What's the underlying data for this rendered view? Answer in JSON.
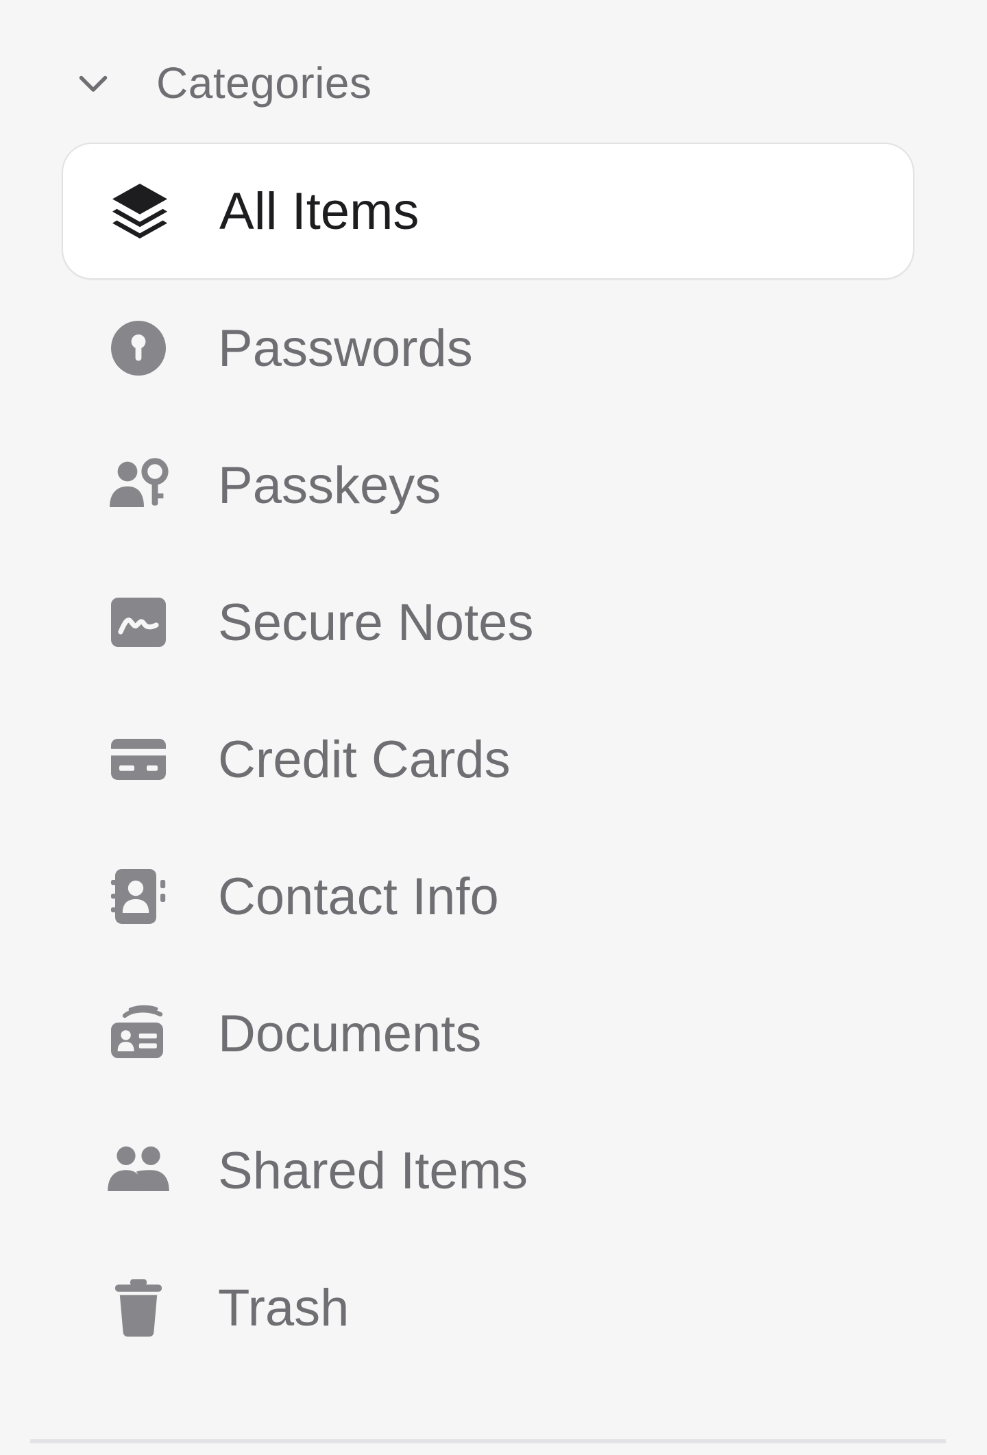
{
  "theme": {
    "background": "#f6f6f6",
    "selected_bg": "#ffffff",
    "text_muted": "#6e6e73",
    "text_selected": "#1d1d1f",
    "icon_muted": "#86868b"
  },
  "section": {
    "title": "Categories",
    "expanded": true,
    "toggle_icon": "chevron-down-icon"
  },
  "categories": [
    {
      "label": "All Items",
      "icon": "layers-icon",
      "selected": true
    },
    {
      "label": "Passwords",
      "icon": "key-icon",
      "selected": false
    },
    {
      "label": "Passkeys",
      "icon": "passkey-icon",
      "selected": false
    },
    {
      "label": "Secure Notes",
      "icon": "note-icon",
      "selected": false
    },
    {
      "label": "Credit Cards",
      "icon": "credit-card-icon",
      "selected": false
    },
    {
      "label": "Contact Info",
      "icon": "contact-book-icon",
      "selected": false
    },
    {
      "label": "Documents",
      "icon": "document-id-icon",
      "selected": false
    },
    {
      "label": "Shared Items",
      "icon": "people-icon",
      "selected": false
    },
    {
      "label": "Trash",
      "icon": "trash-icon",
      "selected": false
    }
  ]
}
